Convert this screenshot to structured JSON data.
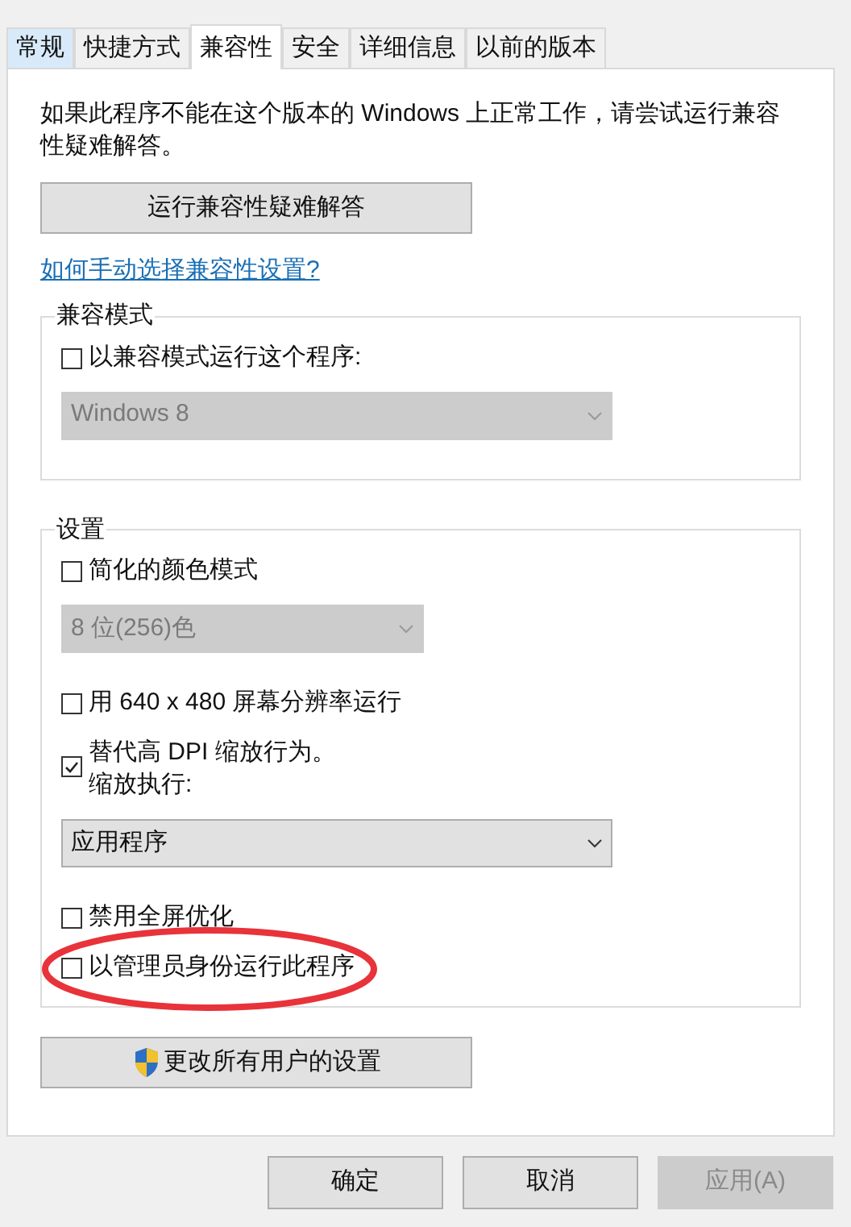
{
  "tabs": [
    {
      "label": "常规",
      "selected": false,
      "hovered": true
    },
    {
      "label": "快捷方式",
      "selected": false,
      "hovered": false
    },
    {
      "label": "兼容性",
      "selected": true,
      "hovered": false
    },
    {
      "label": "安全",
      "selected": false,
      "hovered": false
    },
    {
      "label": "详细信息",
      "selected": false,
      "hovered": false
    },
    {
      "label": "以前的版本",
      "selected": false,
      "hovered": false
    }
  ],
  "description": "如果此程序不能在这个版本的 Windows 上正常工作，请尝试运行兼容性疑难解答。",
  "troubleshoot_button": "运行兼容性疑难解答",
  "help_link": "如何手动选择兼容性设置?",
  "compat_group": {
    "title": "兼容模式",
    "items": [
      {
        "kind": "checkbox",
        "label": "以兼容模式运行这个程序:",
        "checked": false,
        "highlighted": false
      },
      {
        "kind": "dropdown",
        "value": "Windows 8",
        "disabled": true,
        "wide": true
      }
    ]
  },
  "settings_group": {
    "title": "设置",
    "items": [
      {
        "kind": "checkbox",
        "label": "简化的颜色模式",
        "checked": false,
        "highlighted": false
      },
      {
        "kind": "dropdown",
        "value": "8 位(256)色",
        "disabled": true,
        "wide": false
      },
      {
        "kind": "checkbox",
        "label": "用 640 x 480 屏幕分辨率运行",
        "checked": false,
        "highlighted": false
      },
      {
        "kind": "checkbox",
        "label": "替代高 DPI 缩放行为。",
        "sublabel": "缩放执行:",
        "checked": true,
        "highlighted": false
      },
      {
        "kind": "dropdown",
        "value": "应用程序",
        "disabled": false,
        "wide": true
      },
      {
        "kind": "checkbox",
        "label": "禁用全屏优化",
        "checked": false,
        "highlighted": false
      },
      {
        "kind": "checkbox",
        "label": "以管理员身份运行此程序",
        "checked": false,
        "highlighted": true
      }
    ]
  },
  "change_all_button": "更改所有用户的设置",
  "buttons": [
    {
      "label": "确定",
      "disabled": false
    },
    {
      "label": "取消",
      "disabled": false
    },
    {
      "label": "应用(A)",
      "disabled": true
    }
  ]
}
